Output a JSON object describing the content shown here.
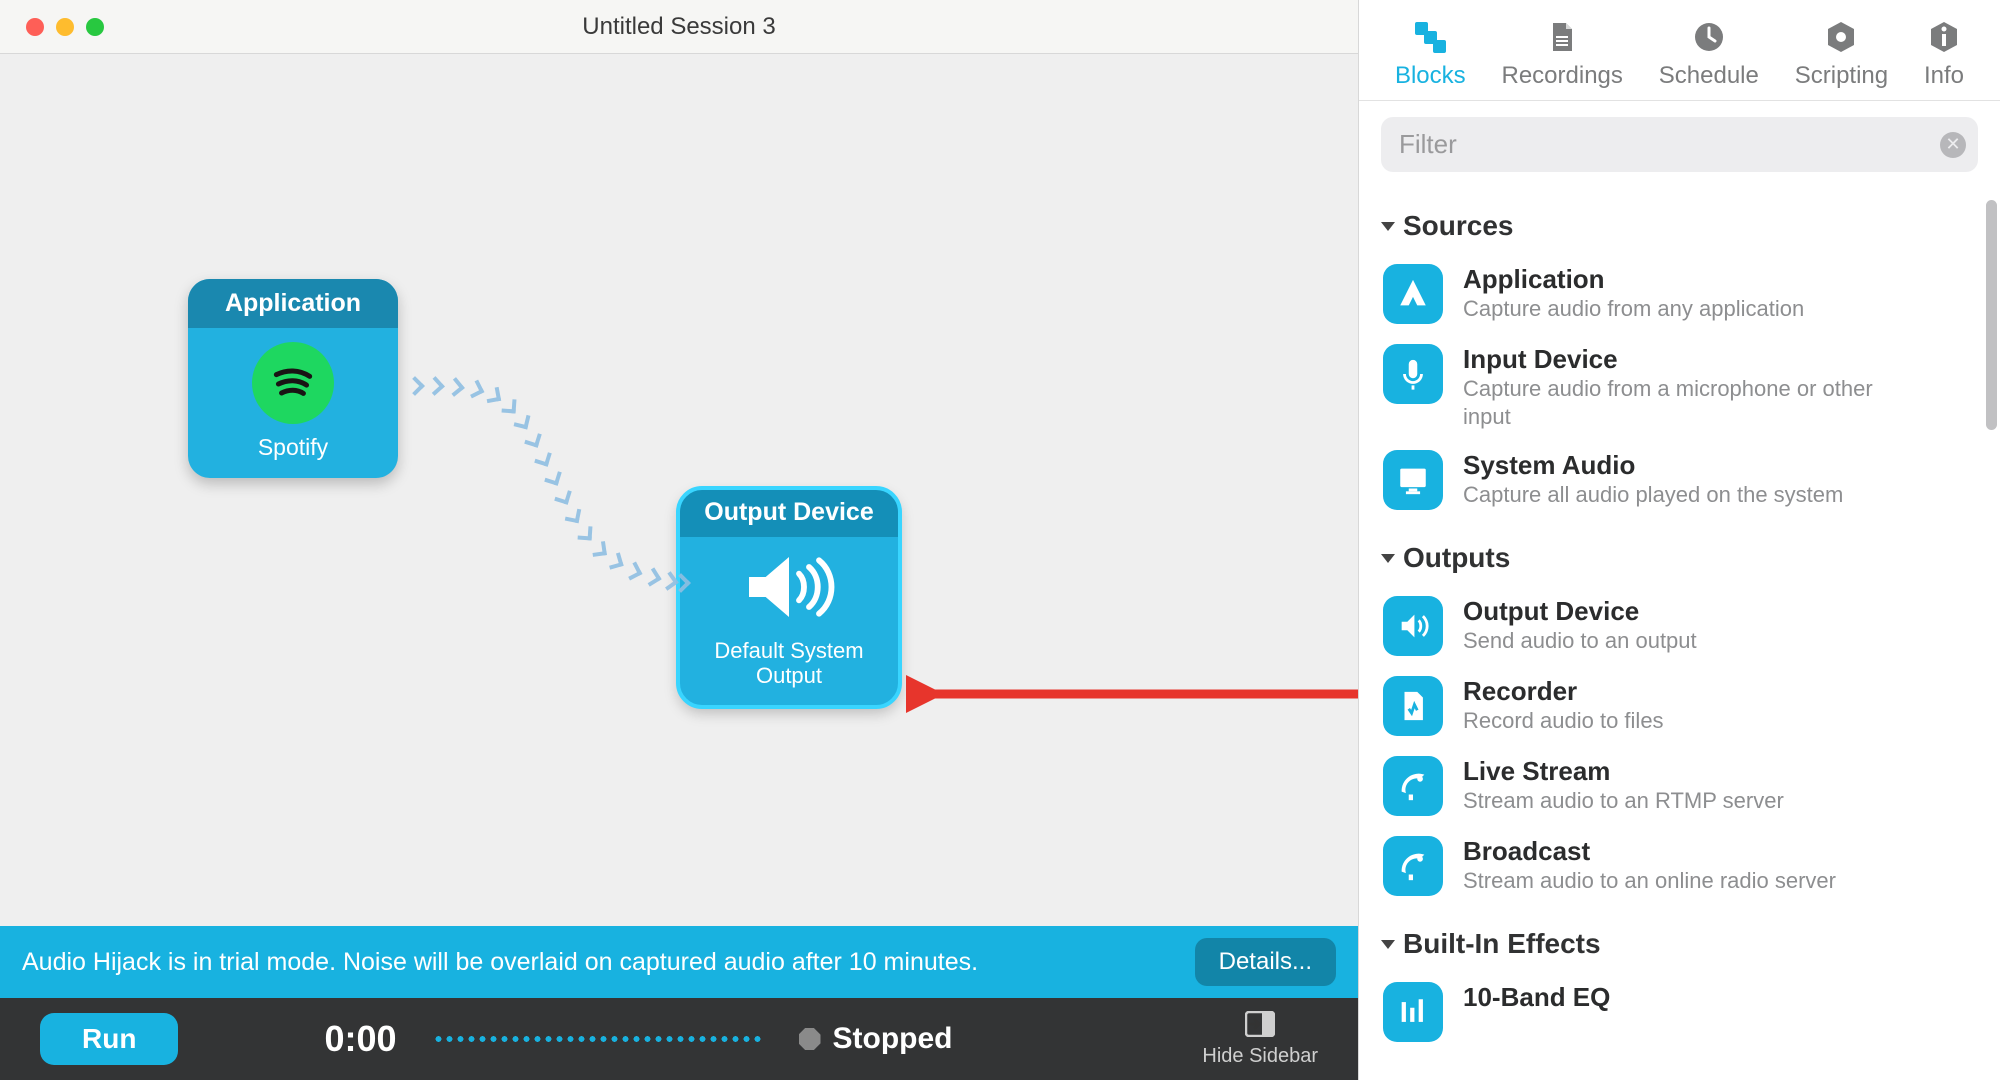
{
  "window": {
    "title": "Untitled Session 3"
  },
  "canvas": {
    "block1": {
      "header": "Application",
      "label": "Spotify"
    },
    "block2": {
      "header": "Output Device",
      "label": "Default System Output"
    }
  },
  "trial": {
    "message": "Audio Hijack is in trial mode. Noise will be overlaid on captured audio after 10 minutes.",
    "details_label": "Details..."
  },
  "bottombar": {
    "run_label": "Run",
    "time": "0:00",
    "status": "Stopped",
    "hide_sidebar_label": "Hide Sidebar"
  },
  "sidebar": {
    "tabs": {
      "blocks": "Blocks",
      "recordings": "Recordings",
      "schedule": "Schedule",
      "scripting": "Scripting",
      "info": "Info"
    },
    "filter_placeholder": "Filter",
    "sections": {
      "sources": {
        "title": "Sources",
        "items": [
          {
            "title": "Application",
            "desc": "Capture audio from any application"
          },
          {
            "title": "Input Device",
            "desc": "Capture audio from a microphone or other",
            "desc2": "input"
          },
          {
            "title": "System Audio",
            "desc": "Capture all audio played on the system"
          }
        ]
      },
      "outputs": {
        "title": "Outputs",
        "items": [
          {
            "title": "Output Device",
            "desc": "Send audio to an output"
          },
          {
            "title": "Recorder",
            "desc": "Record audio to files"
          },
          {
            "title": "Live Stream",
            "desc": "Stream audio to an RTMP server"
          },
          {
            "title": "Broadcast",
            "desc": "Stream audio to an online radio server"
          }
        ]
      },
      "effects": {
        "title": "Built-In Effects",
        "items": [
          {
            "title": "10-Band EQ",
            "desc": ""
          }
        ]
      }
    }
  }
}
